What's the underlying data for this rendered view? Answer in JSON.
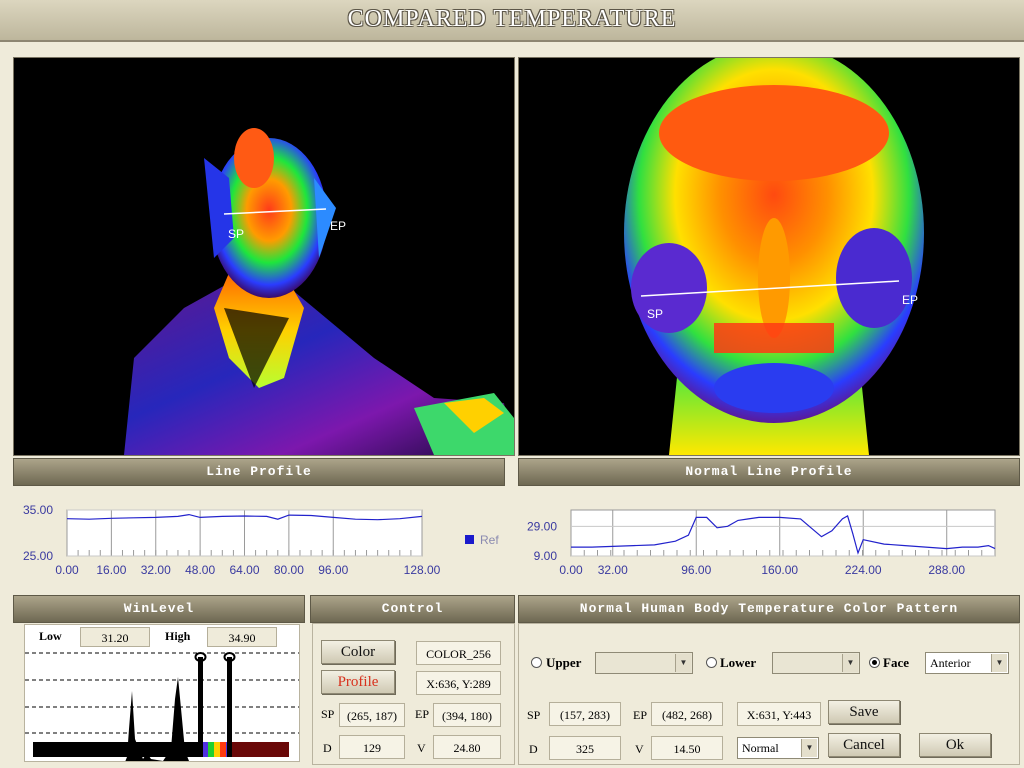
{
  "window": {
    "title": "COMPARED TEMPERATURE"
  },
  "left_image": {
    "sp_label": "SP",
    "ep_label": "EP"
  },
  "right_image": {
    "sp_label": "SP",
    "ep_label": "EP"
  },
  "line_profile": {
    "title": "Line Profile",
    "legend": "Ref",
    "chart_data": {
      "type": "line",
      "xlim": [
        0,
        128
      ],
      "ylim": [
        25,
        35
      ],
      "x_ticks": [
        "0.00",
        "16.00",
        "32.00",
        "48.00",
        "64.00",
        "80.00",
        "96.00",
        "128.00"
      ],
      "y_ticks": [
        "35.00",
        "25.00"
      ],
      "series": [
        {
          "name": "Ref",
          "color": "#2222cc",
          "x": [
            0,
            8,
            16,
            24,
            32,
            40,
            44,
            48,
            56,
            64,
            72,
            76,
            80,
            88,
            96,
            104,
            112,
            120,
            128
          ],
          "y": [
            33.1,
            33.0,
            33.2,
            33.3,
            33.4,
            33.6,
            34.0,
            33.4,
            33.6,
            33.7,
            33.6,
            33.0,
            33.9,
            33.8,
            33.4,
            33.0,
            32.9,
            33.1,
            33.6
          ]
        }
      ]
    }
  },
  "normal_line_profile": {
    "title": "Normal Line Profile",
    "chart_data": {
      "type": "line",
      "xlim": [
        0,
        325
      ],
      "ylim": [
        9,
        40
      ],
      "x_ticks": [
        "0.00",
        "32.00",
        "96.00",
        "160.00",
        "224.00",
        "288.00"
      ],
      "y_ticks": [
        "29.00",
        "9.00"
      ],
      "series": [
        {
          "name": "",
          "color": "#2222cc",
          "x": [
            0,
            16,
            32,
            48,
            64,
            80,
            90,
            96,
            104,
            112,
            120,
            128,
            136,
            144,
            152,
            160,
            176,
            184,
            192,
            200,
            208,
            212,
            216,
            220,
            224,
            240,
            256,
            272,
            288,
            300,
            312,
            320,
            325
          ],
          "y": [
            15,
            15,
            15.5,
            16,
            16.5,
            19,
            23,
            35,
            35,
            28,
            29,
            33,
            34,
            35,
            35,
            35,
            34,
            28,
            22,
            26,
            34,
            36,
            24,
            11,
            20,
            17,
            16,
            15,
            14,
            15,
            15,
            16,
            14
          ]
        }
      ]
    }
  },
  "winlevel": {
    "title": "WinLevel",
    "low_label": "Low",
    "low_value": "31.20",
    "high_label": "High",
    "high_value": "34.90"
  },
  "control": {
    "title": "Control",
    "color_button": "Color",
    "color_value": "COLOR_256",
    "profile_button": "Profile",
    "coord": "X:636, Y:289",
    "sp_label": "SP",
    "sp_value": "(265, 187)",
    "ep_label": "EP",
    "ep_value": "(394, 180)",
    "d_label": "D",
    "d_value": "129",
    "v_label": "V",
    "v_value": "24.80"
  },
  "pattern": {
    "title": "Normal Human Body Temperature Color Pattern",
    "upper_label": "Upper",
    "upper_value": "",
    "lower_label": "Lower",
    "lower_value": "",
    "face_label": "Face",
    "face_value": "Anterior",
    "selected": "Face",
    "sp_label": "SP",
    "sp_value": "(157, 283)",
    "ep_label": "EP",
    "ep_value": "(482, 268)",
    "coord": "X:631, Y:443",
    "d_label": "D",
    "d_value": "325",
    "v_label": "V",
    "v_value": "14.50",
    "mode_value": "Normal",
    "save_button": "Save",
    "cancel_button": "Cancel",
    "ok_button": "Ok"
  },
  "colors": {
    "accent_line": "#2222cc",
    "ref_marker": "#1a1acc"
  }
}
